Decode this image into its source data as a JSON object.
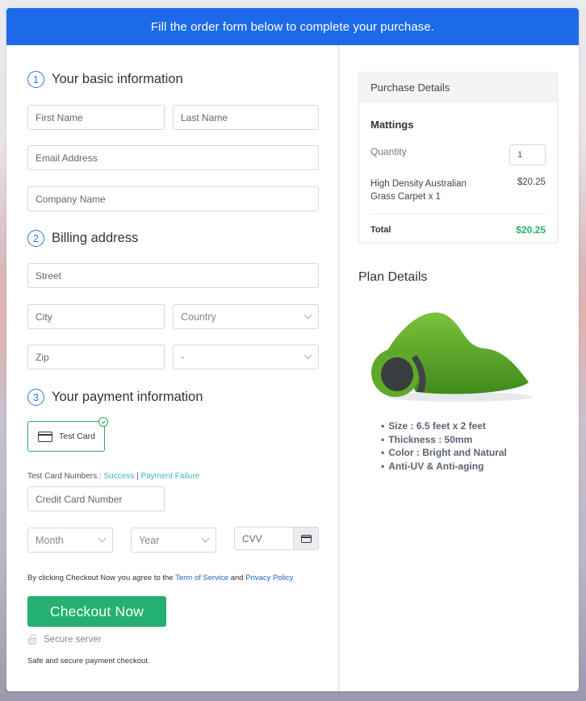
{
  "banner": {
    "text": "Fill the order form below to complete your purchase."
  },
  "sections": {
    "basic": {
      "number": "1",
      "title": "Your basic information"
    },
    "billing": {
      "number": "2",
      "title": "Billing address"
    },
    "payment": {
      "number": "3",
      "title": "Your payment information"
    }
  },
  "fields": {
    "first_name": {
      "placeholder": "First Name",
      "value": ""
    },
    "last_name": {
      "placeholder": "Last Name",
      "value": ""
    },
    "email": {
      "placeholder": "Email Address",
      "value": ""
    },
    "company": {
      "placeholder": "Company Name",
      "value": ""
    },
    "street": {
      "placeholder": "Street",
      "value": ""
    },
    "city": {
      "placeholder": "City",
      "value": ""
    },
    "country": {
      "selected": "Country"
    },
    "zip": {
      "placeholder": "Zip",
      "value": ""
    },
    "state": {
      "selected": "-"
    },
    "card_number": {
      "placeholder": "Credit Card Number",
      "value": ""
    },
    "month": {
      "selected": "Month"
    },
    "year": {
      "selected": "Year"
    },
    "cvv": {
      "placeholder": "CVV",
      "value": ""
    }
  },
  "payment": {
    "method_label": "Test Card",
    "method_selected": true,
    "test_numbers_label": "Test Card Numbers :",
    "success_link": "Success",
    "separator": "|",
    "failure_link": "Payment Failure"
  },
  "legal": {
    "prefix": "By clicking Checkout Now you agree to the",
    "terms_link": "Term of Service",
    "and": "and",
    "privacy_link": "Privacy Policy"
  },
  "checkout": {
    "button_label": "Checkout Now",
    "secure_label": "Secure server",
    "safe_text": "Safe and secure payment checkout."
  },
  "purchase": {
    "heading": "Purchase Details",
    "product": "Mattings",
    "quantity_label": "Quantity",
    "quantity_value": "1",
    "item_name": "High Density Australian Grass Carpet x 1",
    "item_price": "$20.25",
    "total_label": "Total",
    "total_value": "$20.25"
  },
  "plan": {
    "heading": "Plan Details",
    "image_alt": "Artificial grass carpet roll",
    "features": [
      "Size : 6.5 feet x 2 feet",
      "Thickness : 50mm",
      "Color : Bright and Natural",
      "Anti-UV & Anti-aging"
    ]
  },
  "colors": {
    "banner": "#1c6ae8",
    "accent_blue": "#2b74e6",
    "success_green": "#23b070",
    "link_teal": "#3bb4c9",
    "link_blue": "#1e63c5"
  }
}
